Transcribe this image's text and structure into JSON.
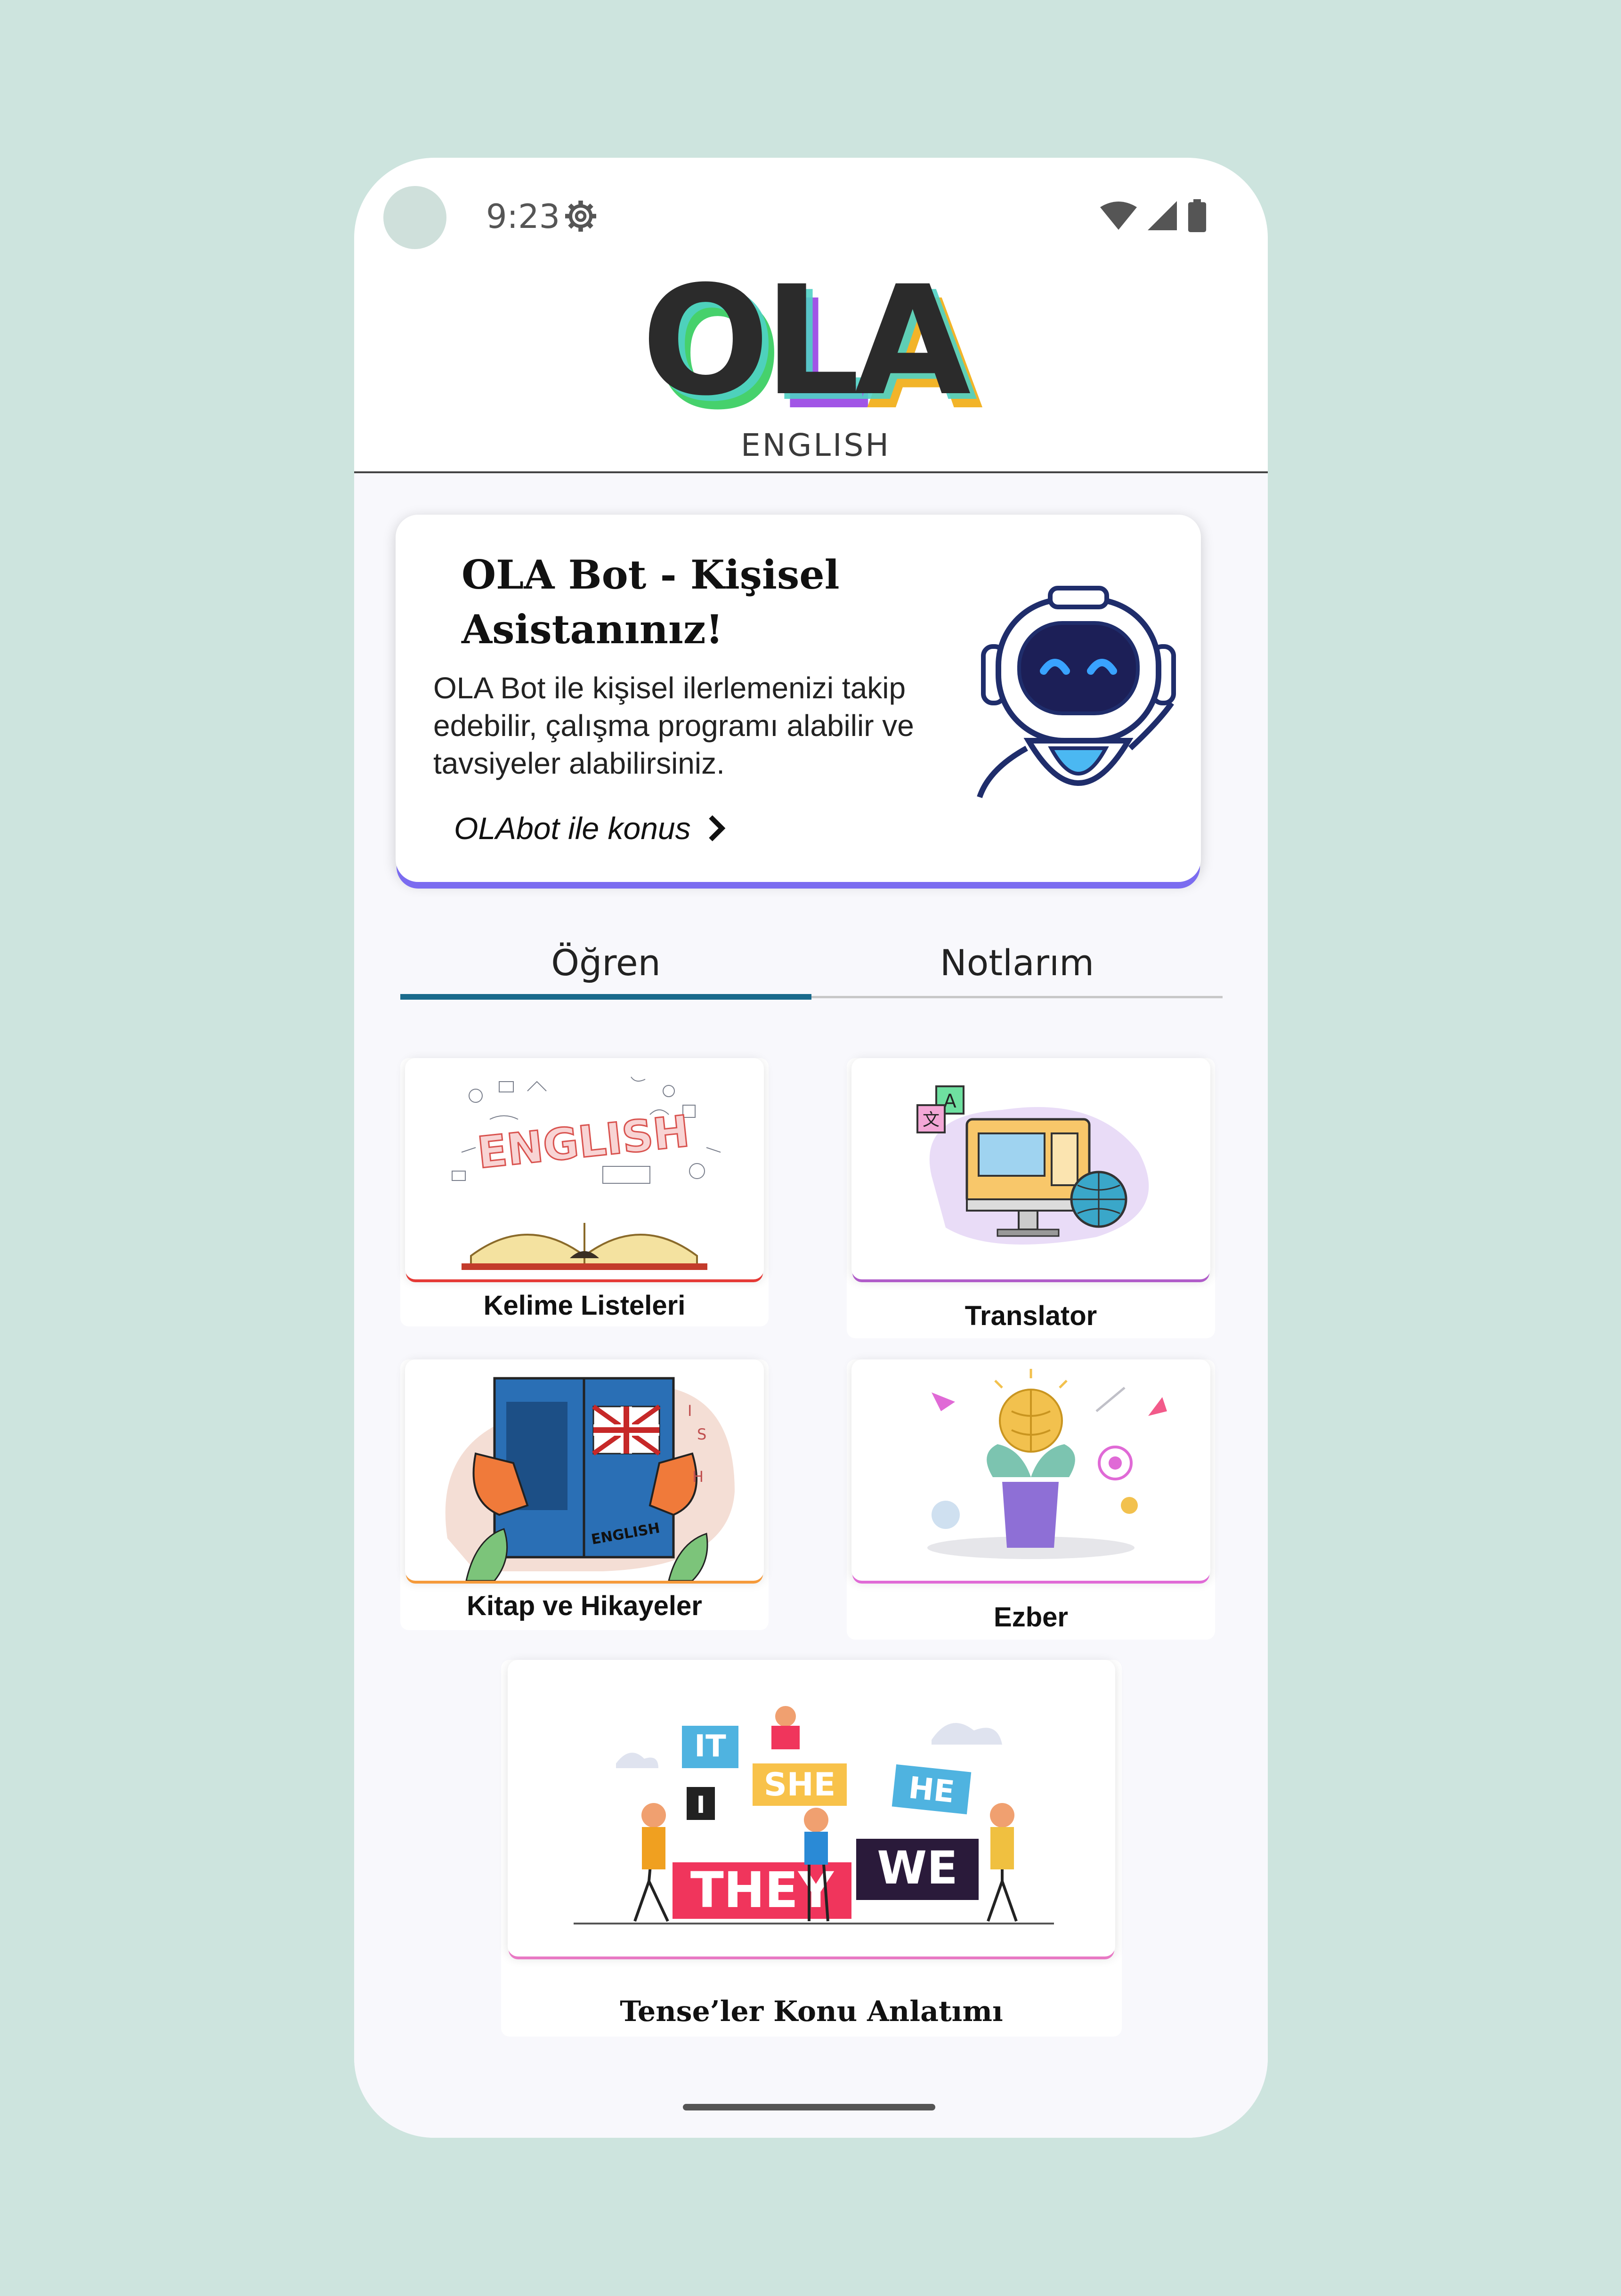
{
  "status_bar": {
    "time": "9:23"
  },
  "header": {
    "logo_main": "OLA",
    "logo_sub": "ENGLISH"
  },
  "bot_card": {
    "title": "OLA Bot - Kişisel Asistanınız!",
    "description": "OLA Bot ile kişisel ilerlemenizi takip edebilir, çalışma programı alabilir ve tavsiyeler alabilirsiniz.",
    "link_label": "OLAbot ile konus"
  },
  "tabs": [
    {
      "label": "Öğren",
      "active": true
    },
    {
      "label": "Notlarım",
      "active": false
    }
  ],
  "cards": [
    {
      "label": "Kelime Listeleri",
      "accent": "#e53935"
    },
    {
      "label": "Translator",
      "accent": "#b05cc9"
    },
    {
      "label": "Kitap ve Hikayeler",
      "accent": "#f59a3a"
    },
    {
      "label": "Ezber",
      "accent": "#e06ad6"
    },
    {
      "label": "Tense’ler Konu Anlatımı",
      "accent": "#e879c4"
    }
  ],
  "illustrations": {
    "tenses_words": [
      "IT",
      "SHE",
      "HE",
      "I",
      "THEY",
      "WE"
    ],
    "book_text": "ENGLISH",
    "book_side_letters": [
      "I",
      "S",
      "H"
    ]
  },
  "colors": {
    "background": "#cde4de",
    "tab_active": "#1a6a8c",
    "bot_card_shadow": "#7b6cf0"
  }
}
